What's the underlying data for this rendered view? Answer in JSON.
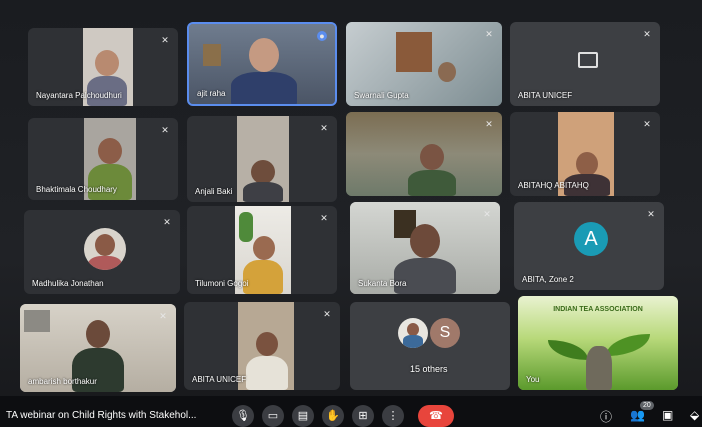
{
  "participants": [
    {
      "name": "Nayantara Palchoudhuri"
    },
    {
      "name": "ajit raha"
    },
    {
      "name": "Swarnali Gupta"
    },
    {
      "name": "ABITA UNICEF"
    },
    {
      "name": "Bhaktimala Choudhary"
    },
    {
      "name": "Anjali Baki"
    },
    {
      "name": ""
    },
    {
      "name": "ABITAHQ ABITAHQ"
    },
    {
      "name": "Madhulika Jonathan"
    },
    {
      "name": "Tilumoni Gogoi"
    },
    {
      "name": "Sukanta Bora"
    },
    {
      "name": "ABITA, Zone 2",
      "avatar_letter": "A"
    },
    {
      "name": "ambarish borthakur"
    },
    {
      "name": "ABITA UNICEF"
    },
    {
      "name": "15 others",
      "avatar_letter": "S"
    },
    {
      "name": "You",
      "banner_text": "INDIAN TEA ASSOCIATION"
    }
  ],
  "meeting": {
    "title": "TA webinar on Child Rights with Stakehol..."
  },
  "controls": {
    "mic_icon": "mic-icon",
    "camera_icon": "camera-icon",
    "captions_icon": "captions-icon",
    "hand_icon": "raise-hand-icon",
    "present_icon": "present-icon",
    "more_icon": "more-options-icon",
    "end_call_icon": "end-call-icon"
  },
  "right_panel": {
    "participants_count": "20"
  },
  "colors": {
    "end_call": "#e8453c",
    "avatar_teal": "#1a9bb5",
    "avatar_brown": "#a0796a",
    "accent_blue": "#5b8dee"
  }
}
